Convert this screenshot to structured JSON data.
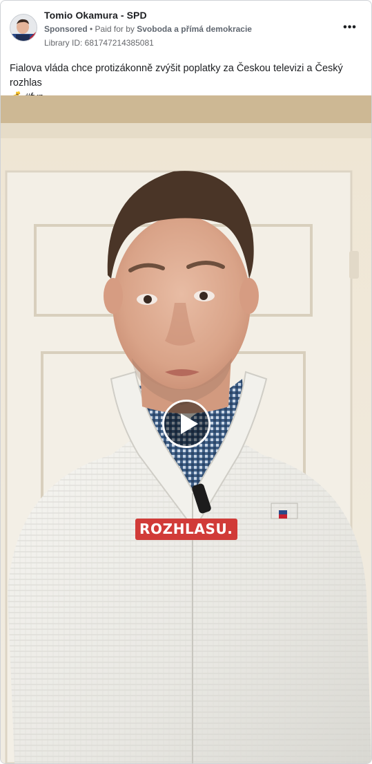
{
  "post": {
    "page_name": "Tomio Okamura - SPD",
    "sponsored_label": "Sponsored",
    "separator": " • ",
    "paid_for_by_label": "Paid for by ",
    "paid_for_by_name": "Svoboda a přímá demokracie",
    "library_id": "Library ID: 681747214385081",
    "more_label": "•••",
    "caption_text": "Fialova vláda chce protizákonně zvýšit poplatky za Českou televizi a Český rozhlas",
    "caption_emoji": "💰",
    "caption_hashtag": "#fyp"
  },
  "video": {
    "subtitle": "ROZHLASU.",
    "play_icon": "play-icon",
    "subtitle_color": "#d13b38"
  },
  "icons": {
    "avatar": "avatar",
    "more": "more-options-icon",
    "money_bag": "money-bag-icon"
  }
}
